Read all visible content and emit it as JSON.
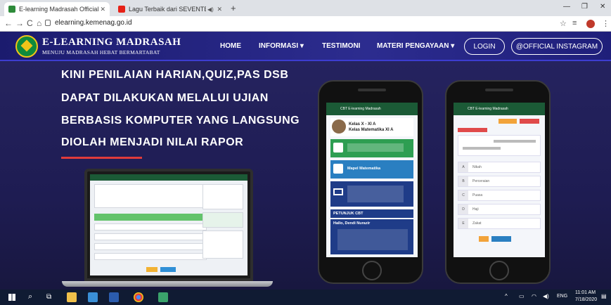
{
  "browser": {
    "tabs": [
      {
        "title": "E-learning Madrasah Official",
        "favicon_color": "#2e8b3a"
      },
      {
        "title": "Lagu Terbaik dari SEVENTEE",
        "favicon_color": "#e62117"
      }
    ],
    "url": "elearning.kemenag.go.id"
  },
  "site": {
    "brand": "E-LEARNING MADRASAH",
    "tagline": "MENUJU MADRASAH HEBAT BERMARTABAT",
    "nav": [
      {
        "label": "HOME"
      },
      {
        "label": "INFORMASI ▾"
      },
      {
        "label": "TESTIMONI"
      },
      {
        "label": "MATERI PENGAYAAN ▾"
      }
    ],
    "login_label": "LOGIN",
    "instagram_label": "@OFFICIAL INSTAGRAM"
  },
  "hero": {
    "lines": [
      "KINI PENILAIAN HARIAN,QUIZ,PAS DSB",
      "DAPAT DILAKUKAN MELALUI UJIAN",
      "BERBASIS KOMPUTER YANG LANGSUNG",
      "DIOLAH MENJADI NILAI RAPOR"
    ]
  },
  "phone1": {
    "header": "CBT E-learning Madrasah",
    "class_name": "Kelas X - XI A",
    "subject_class": "Kelas Matematika XI A",
    "subject_title": "Mapel Matematika",
    "instructions_title": "PETUNJUK CBT",
    "greeting": "Hallo, Dendi Nurazir"
  },
  "phone2": {
    "header": "CBT E-learning Madrasah",
    "options": [
      {
        "letter": "A",
        "text": "Nikah"
      },
      {
        "letter": "B",
        "text": "Perceraian"
      },
      {
        "letter": "C",
        "text": "Puasa"
      },
      {
        "letter": "D",
        "text": "Haji"
      },
      {
        "letter": "E",
        "text": "Zakat"
      }
    ]
  },
  "taskbar": {
    "time": "11:01 AM",
    "date": "7/18/2020",
    "lang": "ENG"
  },
  "colors": {
    "nav_bg": "#2c2c8f",
    "hero_bg": "#25235f",
    "accent_red": "#e03b3b",
    "app_green": "#1b5a36"
  }
}
